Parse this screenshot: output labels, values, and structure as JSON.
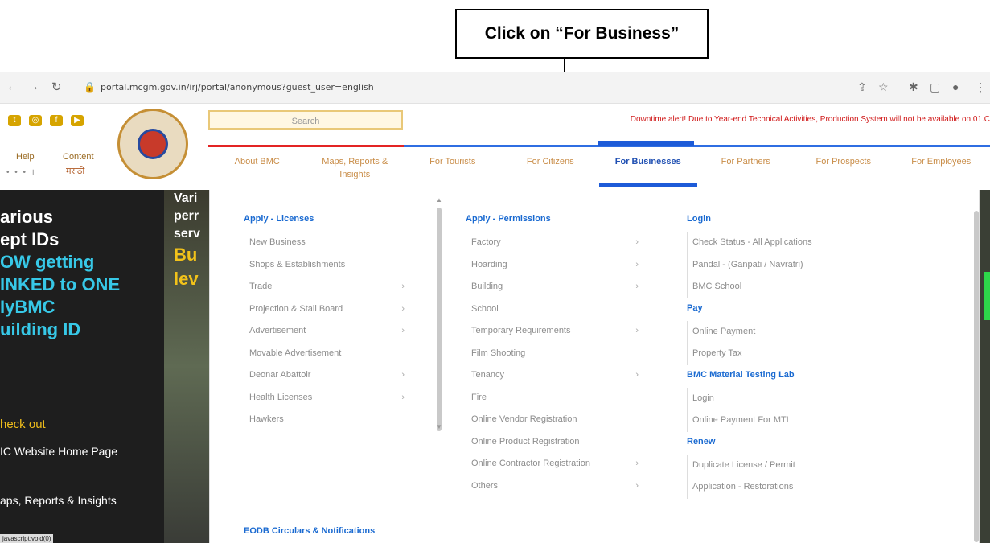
{
  "callout": {
    "text": "Click on “For Business”"
  },
  "browser": {
    "url": "portal.mcgm.gov.in/irj/portal/anonymous?guest_user=english",
    "back_icon": "arrow-left-icon",
    "forward_icon": "arrow-right-icon",
    "reload_icon": "reload-icon",
    "lock_icon": "lock-icon"
  },
  "header": {
    "search_placeholder": "Search",
    "alert": "Downtime alert! Due to Year-end Technical Activities, Production System will not be available on 01.C",
    "help": "Help",
    "content": "Content",
    "lang_a": "• • • ॥",
    "lang_b": "मराठी",
    "menu": [
      {
        "label": "About BMC"
      },
      {
        "label": "Maps, Reports & Insights"
      },
      {
        "label": "For Tourists"
      },
      {
        "label": "For Citizens"
      },
      {
        "label": "For Businesses"
      },
      {
        "label": "For Partners"
      },
      {
        "label": "For Prospects"
      },
      {
        "label": "For Employees"
      }
    ]
  },
  "hero": {
    "title_lines": [
      "arious",
      "ept IDs",
      "OW getting",
      "INKED to ONE",
      "IyBMC",
      "uilding ID"
    ],
    "partial_lines": [
      "Vari",
      "perr",
      "serv",
      "Bu",
      "lev"
    ],
    "checkout": "heck out",
    "links": [
      "IC Website Home Page",
      "aps, Reports & Insights"
    ],
    "status": "javascript:void(0)"
  },
  "dropdown": {
    "col1": {
      "heading": "Apply - Licenses",
      "items": [
        "New Business",
        "Shops & Establishments",
        "Trade",
        "Projection & Stall Board",
        "Advertisement",
        "Movable Advertisement",
        "Deonar Abattoir",
        "Health Licenses",
        "Hawkers"
      ],
      "section_heading": "EODB Circulars & Notifications"
    },
    "col2": {
      "heading": "Apply - Permissions",
      "items": [
        "Factory",
        "Hoarding",
        "Building",
        "School",
        "Temporary Requirements",
        "Film Shooting",
        "Tenancy",
        "Fire",
        "Online Vendor Registration",
        "Online Product Registration",
        "Online Contractor Registration",
        "Others"
      ]
    },
    "col3": {
      "login_heading": "Login",
      "login_items": [
        "Check Status - All Applications",
        "Pandal - (Ganpati / Navratri)",
        "BMC School"
      ],
      "pay_heading": "Pay",
      "pay_items": [
        "Online Payment",
        "Property Tax"
      ],
      "lab_heading": "BMC Material Testing Lab",
      "lab_items": [
        "Login",
        "Online Payment For MTL"
      ],
      "renew_heading": "Renew",
      "renew_items": [
        "Duplicate License / Permit",
        "Application - Restorations"
      ]
    },
    "chevron": "›"
  }
}
